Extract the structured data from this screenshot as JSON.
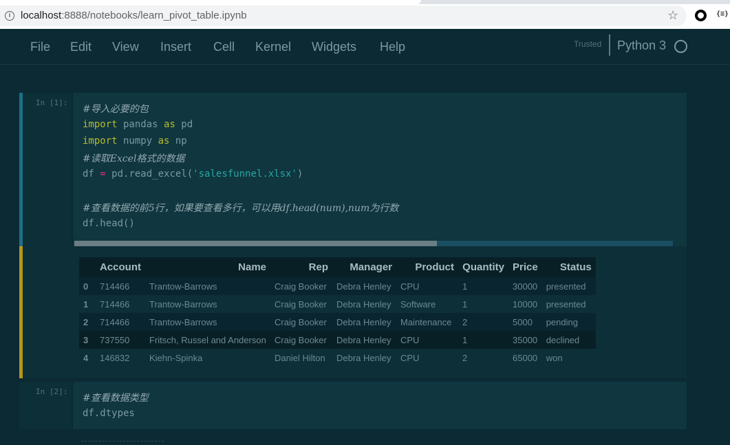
{
  "browser": {
    "url_host": "localhost",
    "url_rest": ":8888/notebooks/learn_pivot_table.ipynb",
    "info_icon": "info-icon",
    "bookmark_icon": "star-icon",
    "extension_json_label": "{≡}"
  },
  "menu": {
    "items": [
      "File",
      "Edit",
      "View",
      "Insert",
      "Cell",
      "Kernel",
      "Widgets",
      "Help"
    ],
    "trusted": "Trusted",
    "kernel_name": "Python 3"
  },
  "cell1": {
    "prompt": "In  [1]:",
    "lines": {
      "c1": "#导入必要的包",
      "l2_kw": "import",
      "l2_mod": " pandas ",
      "l2_as": "as",
      "l2_alias": " pd",
      "l3_kw": "import",
      "l3_mod": " numpy ",
      "l3_as": "as",
      "l3_alias": " np",
      "c4": "#读取Excel格式的数据",
      "l5_a": "df ",
      "l5_op": "=",
      "l5_b": " pd.read_excel(",
      "l5_str": "'salesfunnel.xlsx'",
      "l5_c": ")",
      "c7": "#查看数据的前5行，如果要查看多行，可以用df.head(num),num为行数",
      "l8": "df.head()"
    }
  },
  "output1": {
    "columns": [
      "",
      "Account",
      "Name",
      "Rep",
      "Manager",
      "Product",
      "Quantity",
      "Price",
      "Status"
    ],
    "rows": [
      [
        "0",
        "714466",
        "Trantow-Barrows",
        "Craig Booker",
        "Debra Henley",
        "CPU",
        "1",
        "30000",
        "presented"
      ],
      [
        "1",
        "714466",
        "Trantow-Barrows",
        "Craig Booker",
        "Debra Henley",
        "Software",
        "1",
        "10000",
        "presented"
      ],
      [
        "2",
        "714466",
        "Trantow-Barrows",
        "Craig Booker",
        "Debra Henley",
        "Maintenance",
        "2",
        "5000",
        "pending"
      ],
      [
        "3",
        "737550",
        "Fritsch, Russel and Anderson",
        "Craig Booker",
        "Debra Henley",
        "CPU",
        "1",
        "35000",
        "declined"
      ],
      [
        "4",
        "146832",
        "Kiehn-Spinka",
        "Daniel Hilton",
        "Debra Henley",
        "CPU",
        "2",
        "65000",
        "won"
      ]
    ]
  },
  "cell2": {
    "prompt": "In  [2]:",
    "c1": "#查看数据类型",
    "l2": "df.dtypes"
  },
  "colors": {
    "background": "#0b2a33",
    "selected_bar": "#1f6f87",
    "output_bar": "#b8961a",
    "keyword": "#b7bb2a",
    "operator": "#d6337f",
    "string": "#28a5a0"
  }
}
